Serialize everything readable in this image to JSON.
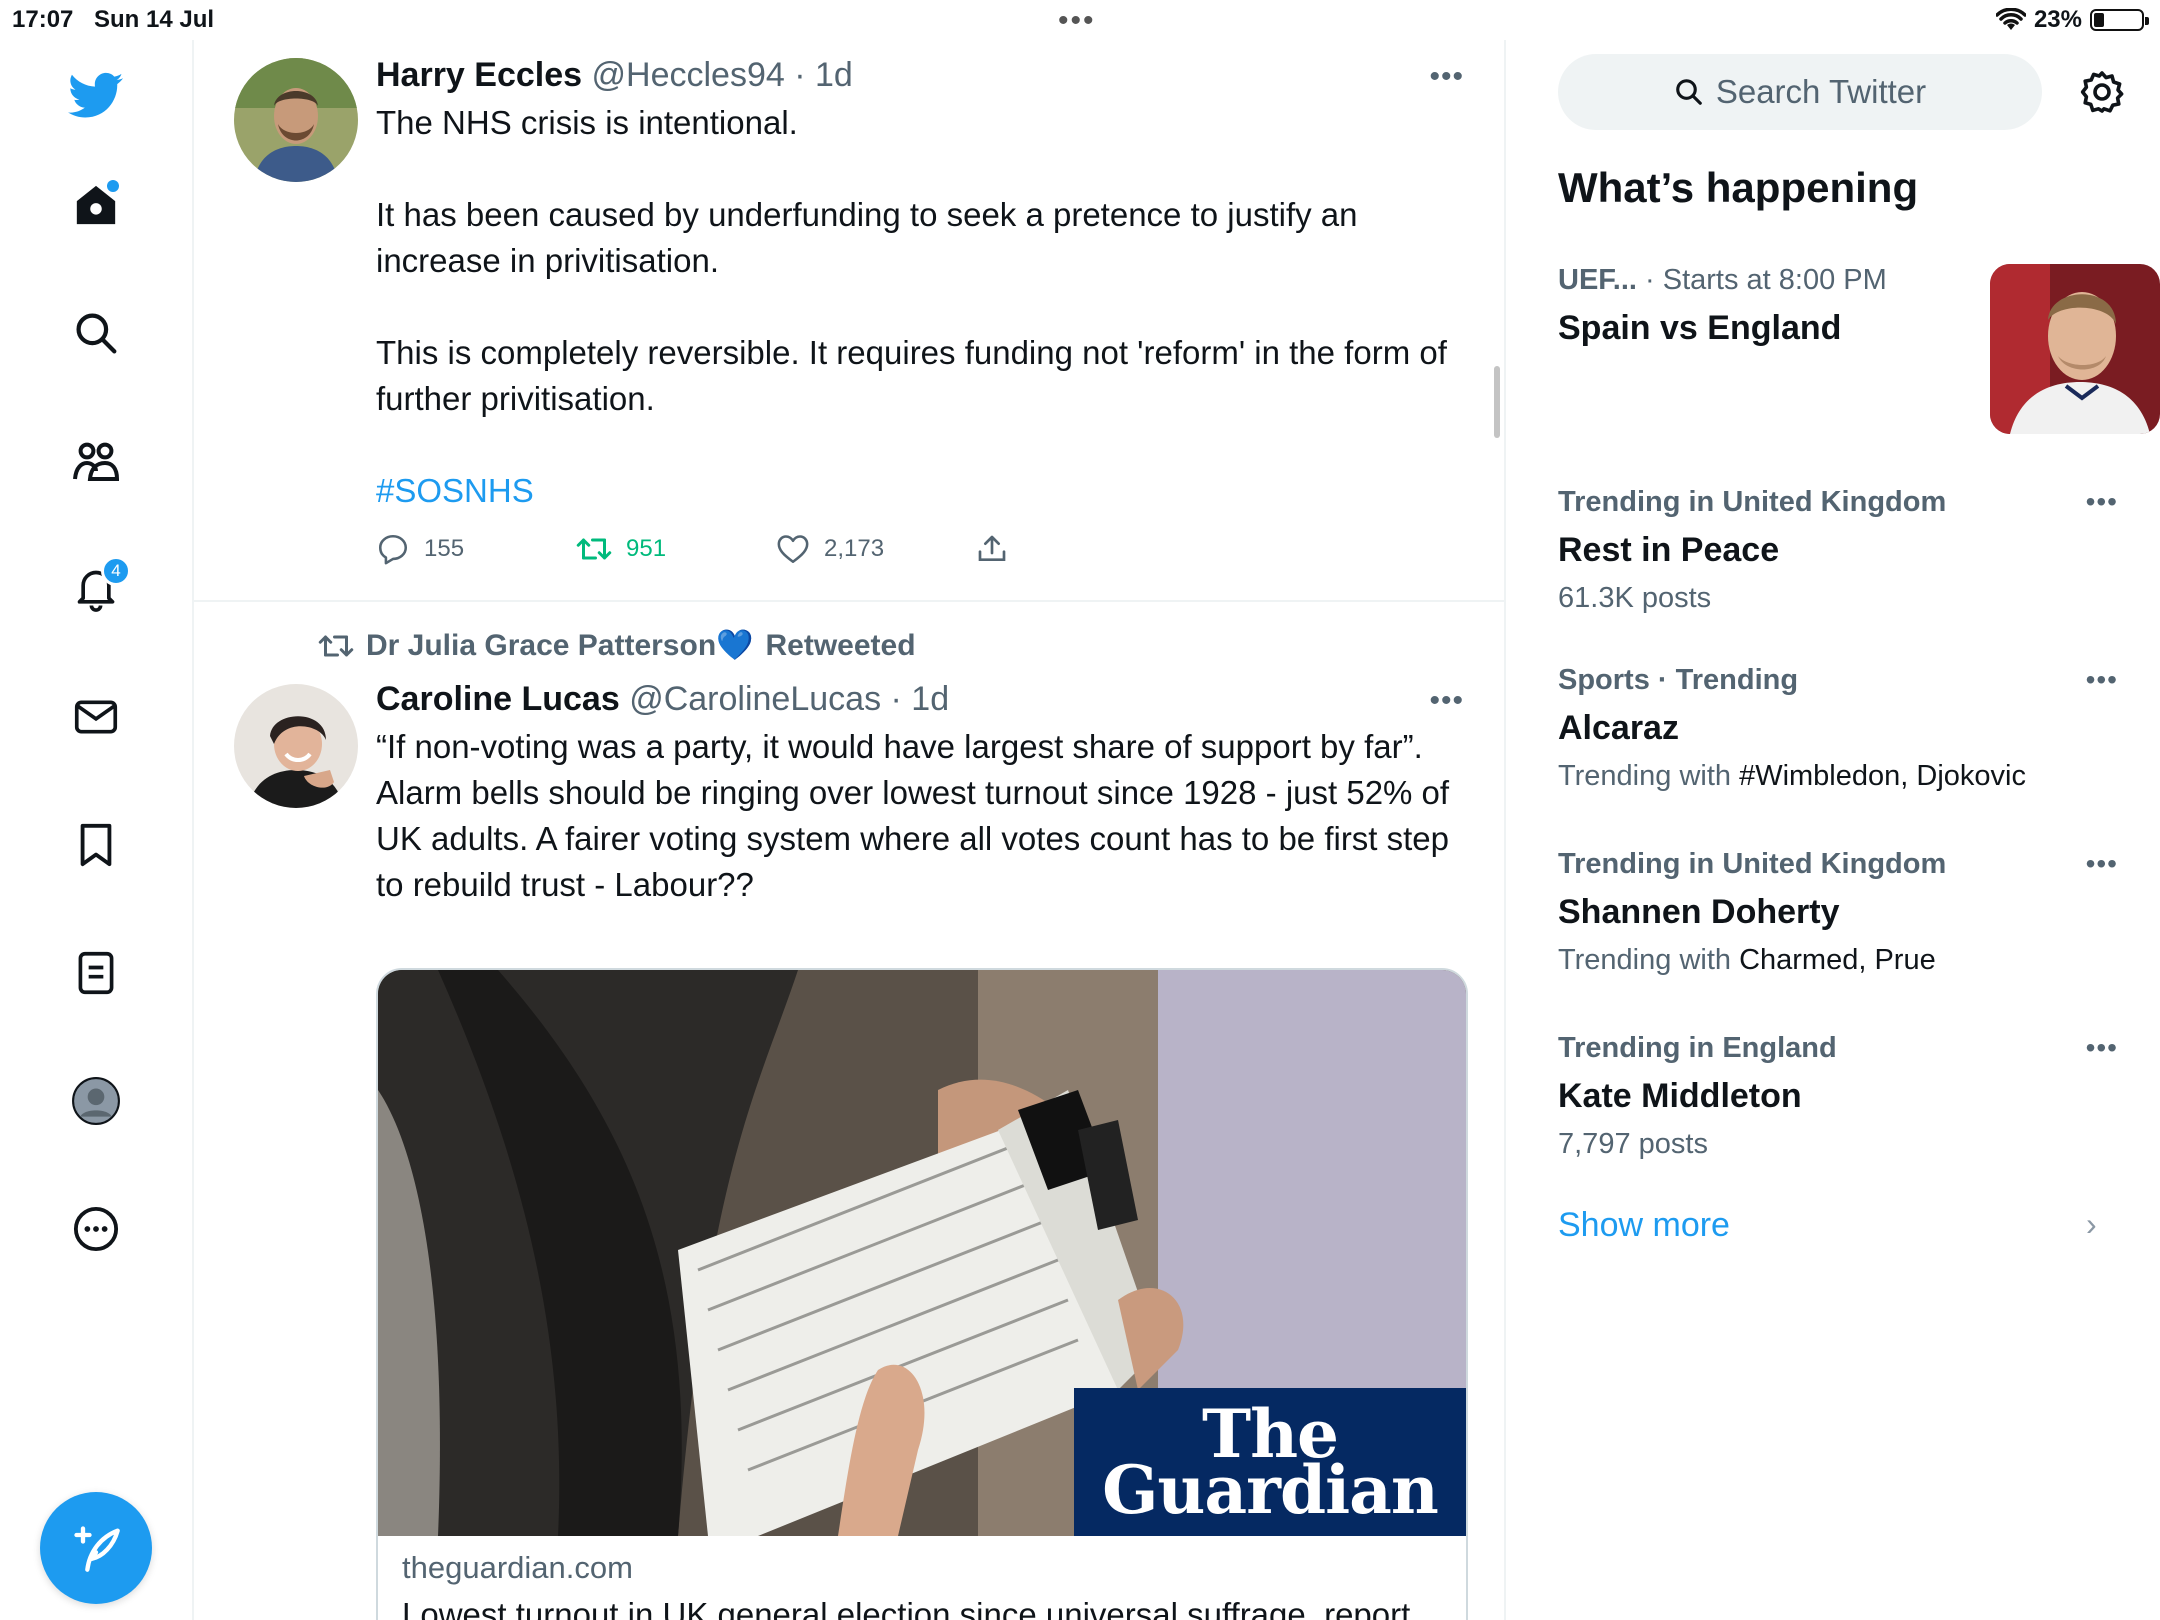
{
  "status_bar": {
    "time": "17:07",
    "date": "Sun 14 Jul",
    "battery": "23%"
  },
  "nav": {
    "notifications_count": "4"
  },
  "tweets": [
    {
      "name": "Harry Eccles",
      "meta": "@Heccles94 · 1d",
      "paragraphs": [
        "The NHS crisis is intentional.",
        "It has been caused by underfunding to seek a pretence to justify an increase in privitisation.",
        "This is completely reversible. It requires funding not 'reform' in the form of further privitisation."
      ],
      "hashtag": "#SOSNHS",
      "replies": "155",
      "retweets": "951",
      "likes": "2,173"
    },
    {
      "retweeted_by": "Dr Julia Grace Patterson💙",
      "retweeted_label": "Retweeted",
      "name": "Caroline Lucas",
      "meta": "@CarolineLucas · 1d",
      "text": "“If non-voting was a party, it would have  largest share of support by far”. Alarm bells should be ringing over lowest turnout since 1928 - just 52% of UK adults. A fairer voting system where all votes count has to be first step to rebuild trust - Labour??",
      "card": {
        "logo_line1": "The",
        "logo_line2": "Guardian",
        "domain": "theguardian.com",
        "title": "Lowest turnout in UK general election since universal suffrage, report shows"
      }
    }
  ],
  "sidebar": {
    "search_placeholder": "Search Twitter",
    "whats_happening": "What’s happening",
    "trends": [
      {
        "meta_a": "UEF...",
        "meta_b": " · Starts at 8:00 PM",
        "title": "Spain vs England"
      },
      {
        "meta": "Trending in United Kingdom",
        "title": "Rest in Peace",
        "sub": "61.3K posts"
      },
      {
        "meta": "Sports · Trending",
        "title": "Alcaraz",
        "sub_prefix": "Trending with ",
        "sub_strong": "#Wimbledon, Djokovic"
      },
      {
        "meta": "Trending in United Kingdom",
        "title": "Shannen Doherty",
        "sub_prefix": "Trending with ",
        "sub_strong": "Charmed, Prue"
      },
      {
        "meta": "Trending in England",
        "title": "Kate Middleton",
        "sub": "7,797 posts"
      }
    ],
    "show_more": "Show more"
  },
  "colors": {
    "accent": "#1d9bf0",
    "retweet": "#00ba7c",
    "guardian_bg": "#052962",
    "muted": "#536471"
  }
}
